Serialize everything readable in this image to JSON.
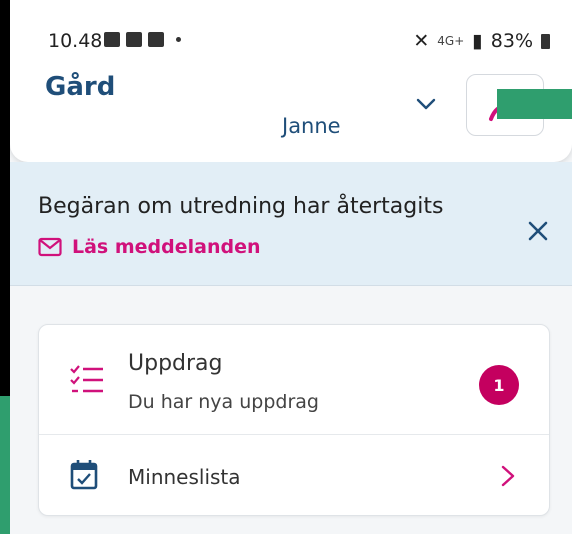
{
  "status_bar": {
    "time": "10.48",
    "network": "4G+",
    "battery": "83%"
  },
  "header": {
    "farm_title": "Gård",
    "user_name": "Janne"
  },
  "banner": {
    "title": "Begäran om utredning har återtagits",
    "link_label": "Läs meddelanden"
  },
  "card": {
    "uppdrag": {
      "title": "Uppdrag",
      "subtitle": "Du har nya uppdrag",
      "badge_count": "1"
    },
    "minneslista": {
      "label": "Minneslista"
    }
  },
  "colors": {
    "primary_blue": "#1f4e79",
    "accent_magenta": "#d0117b",
    "badge": "#c4005f",
    "banner_bg": "#e2eef6",
    "overlay_green": "#2f9e6e"
  },
  "icons": {
    "chevron": "chevron-down-icon",
    "avatar": "user-icon",
    "mail": "mail-icon",
    "close": "close-icon",
    "tasks": "task-list-icon",
    "calendar": "calendar-check-icon",
    "row_chevron": "chevron-right-icon"
  }
}
